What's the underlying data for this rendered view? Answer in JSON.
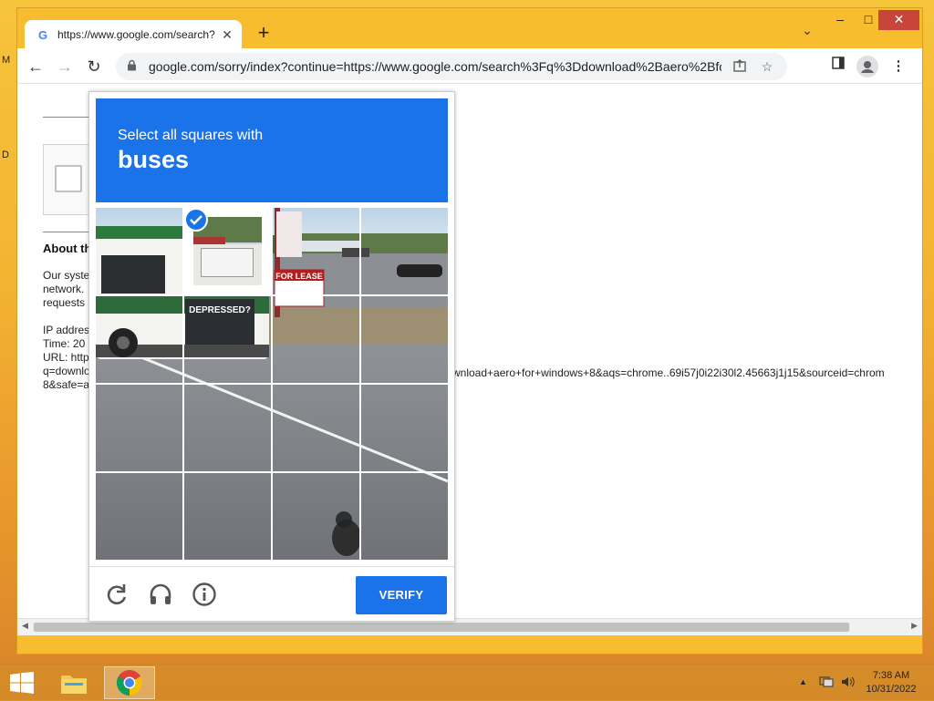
{
  "desktop": {
    "side_letter_1": "M",
    "side_letter_2": "D"
  },
  "browser": {
    "tab_title": "https://www.google.com/search?",
    "tab_favicon": "G",
    "new_tab": "+",
    "tab_search": "⌄",
    "window_buttons": {
      "minimize": "‒",
      "maximize": "□",
      "close": "✕"
    },
    "nav": {
      "back": "←",
      "forward": "→",
      "reload": "↻"
    },
    "url": "google.com/sorry/index?continue=https://www.google.com/search%3Fq%3Ddownload%2Baero%2Bfor%2..."
  },
  "page": {
    "about_heading": "About th",
    "para_lines": [
      "Our syste",
      "network.",
      "requests"
    ],
    "ip_line": "IP addres",
    "time_line": "Time: 20",
    "url_line": "URL: http",
    "q_line": "q=downlo",
    "safe_line": "8&safe=a",
    "url_continued": "wnload+aero+for+windows+8&aqs=chrome..69i57j0i22i30l2.45663j1j15&sourceid=chrom"
  },
  "captcha": {
    "instruction": "Select all squares with",
    "target": "buses",
    "verify_label": "VERIFY",
    "grid_rows": 4,
    "grid_cols": 4,
    "selected_tiles": [
      [
        0,
        1
      ]
    ],
    "bus_sign": "DEPRESSED?",
    "lease_sign": "FOR LEASE"
  },
  "taskbar": {
    "time": "7:38 AM",
    "date": "10/31/2022"
  },
  "colors": {
    "accent": "#1a73e8",
    "close": "#c7453a"
  }
}
